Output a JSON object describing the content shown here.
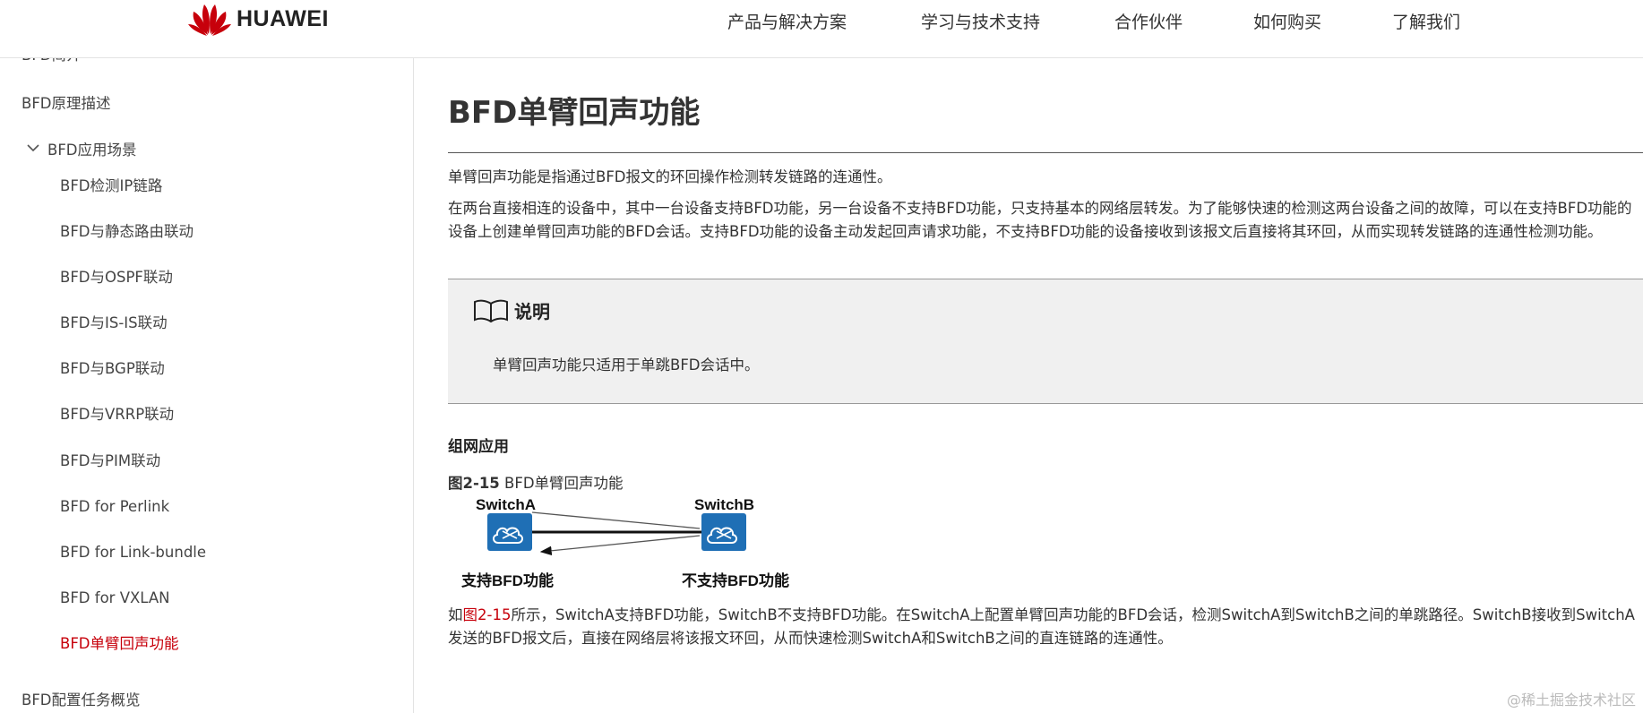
{
  "header": {
    "brand": "HUAWEI",
    "nav": [
      {
        "label": "产品与解决方案"
      },
      {
        "label": "学习与技术支持"
      },
      {
        "label": "合作伙伴"
      },
      {
        "label": "如何购买"
      },
      {
        "label": "了解我们"
      }
    ]
  },
  "sidebar": {
    "items": [
      {
        "label": "BFD简介"
      },
      {
        "label": "BFD原理描述"
      },
      {
        "label": "BFD应用场景",
        "expanded": true
      },
      {
        "label": "BFD检测IP链路"
      },
      {
        "label": "BFD与静态路由联动"
      },
      {
        "label": "BFD与OSPF联动"
      },
      {
        "label": "BFD与IS-IS联动"
      },
      {
        "label": "BFD与BGP联动"
      },
      {
        "label": "BFD与VRRP联动"
      },
      {
        "label": "BFD与PIM联动"
      },
      {
        "label": "BFD for Perlink"
      },
      {
        "label": "BFD for Link-bundle"
      },
      {
        "label": "BFD for VXLAN"
      },
      {
        "label": "BFD单臂回声功能",
        "active": true
      },
      {
        "label": "BFD配置任务概览"
      }
    ],
    "active_color": "#c7000b"
  },
  "main": {
    "title": "BFD单臂回声功能",
    "para1": "单臂回声功能是指通过BFD报文的环回操作检测转发链路的连通性。",
    "para2": "在两台直接相连的设备中，其中一台设备支持BFD功能，另一台设备不支持BFD功能，只支持基本的网络层转发。为了能够快速的检测这两台设备之间的故障，可以在支持BFD功能的设备上创建单臂回声功能的BFD会话。支持BFD功能的设备主动发起回声请求功能，不支持BFD功能的设备接收到该报文后直接将其环回，从而实现转发链路的连通性检测功能。",
    "note": {
      "title": "说明",
      "text": "单臂回声功能只适用于单跳BFD会话中。"
    },
    "section_title": "组网应用",
    "figure": {
      "caption_num": "图2-15",
      "caption_text": " BFD单臂回声功能",
      "switch_a": "SwitchA",
      "switch_b": "SwitchB",
      "label_a": "支持BFD功能",
      "label_b": "不支持BFD功能"
    },
    "para3_prefix": "如",
    "para3_link": "图2-15",
    "para3_rest": "所示，SwitchA支持BFD功能，SwitchB不支持BFD功能。在SwitchA上配置单臂回声功能的BFD会话，检测SwitchA到SwitchB之间的单跳路径。SwitchB接收到SwitchA发送的BFD报文后，直接在网络层将该报文环回，从而快速检测SwitchA和SwitchB之间的直连链路的连通性。"
  },
  "watermark": "@稀土掘金技术社区",
  "colors": {
    "brand_red": "#c7000b",
    "switch_blue": "#1f6fb5"
  }
}
